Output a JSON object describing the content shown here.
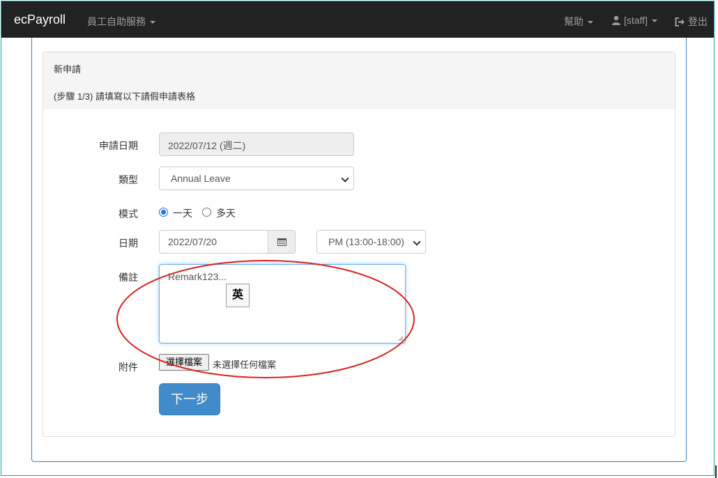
{
  "navbar": {
    "brand": "ecPayroll",
    "menu_self_service": "員工自助服務",
    "menu_help": "幫助",
    "menu_user": "[staff]",
    "menu_logout": "登出"
  },
  "panel": {
    "title": "新申請",
    "step": "(步驟 1/3) 請填寫以下請假申請表格"
  },
  "form": {
    "apply_date_label": "申請日期",
    "apply_date_value": "2022/07/12 (週二)",
    "type_label": "類型",
    "type_value": "Annual Leave",
    "mode_label": "模式",
    "mode_one_day": "一天",
    "mode_multi_day": "多天",
    "date_label": "日期",
    "date_value": "2022/07/20",
    "period_value": "PM (13:00-18:00)",
    "remark_label": "備註",
    "remark_value": "Remark123...",
    "ime_indicator": "英",
    "attachment_label": "附件",
    "file_button": "選擇檔案",
    "file_status": "未選擇任何檔案",
    "next_button": "下一步"
  },
  "colors": {
    "navbar_bg": "#222222",
    "primary": "#428bca",
    "annotation": "#d9211c"
  }
}
